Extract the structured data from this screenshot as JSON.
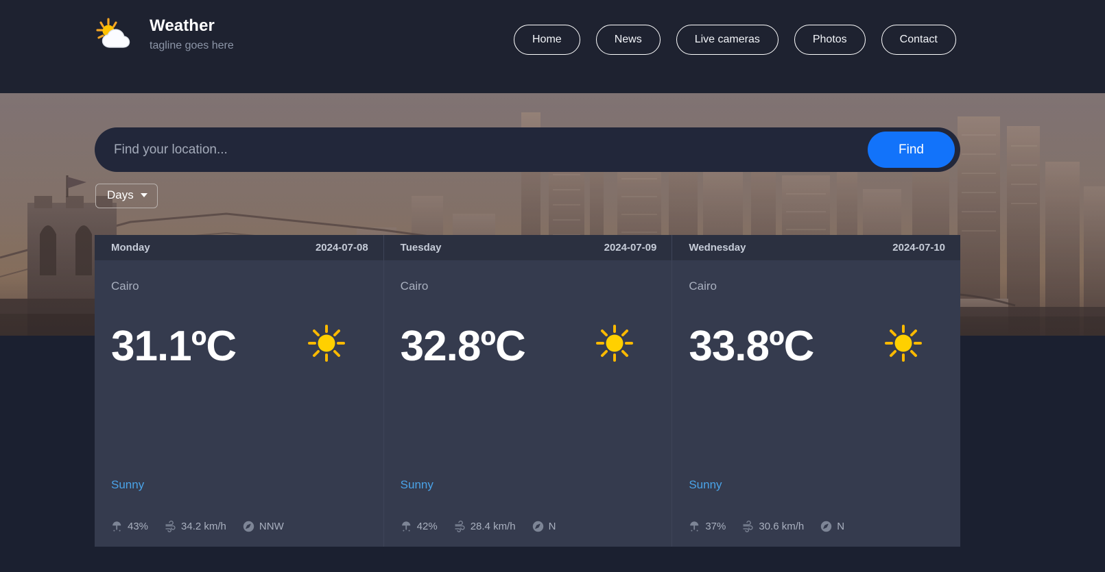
{
  "brand": {
    "title": "Weather",
    "tagline": "tagline goes here",
    "logo_icon": "sun-behind-cloud-icon"
  },
  "nav": {
    "items": [
      {
        "label": "Home"
      },
      {
        "label": "News"
      },
      {
        "label": "Live cameras"
      },
      {
        "label": "Photos"
      },
      {
        "label": "Contact"
      }
    ]
  },
  "search": {
    "placeholder": "Find your location...",
    "value": "",
    "button_label": "Find"
  },
  "filter": {
    "days_label": "Days"
  },
  "colors": {
    "accent_blue": "#1273fa",
    "link_blue": "#4aa3e8",
    "navbar_bg": "#1e2230",
    "card_bg": "#353b4e",
    "card_head_bg": "#2b3040",
    "page_bg": "#1b2030",
    "sun_yellow": "#ffc400"
  },
  "forecast": {
    "cards": [
      {
        "weekday": "Monday",
        "date": "2024-07-08",
        "city": "Cairo",
        "temperature": "31.1ºC",
        "icon": "sun-icon",
        "condition": "Sunny",
        "precipitation": "43%",
        "wind": "34.2 km/h",
        "wind_direction": "NNW"
      },
      {
        "weekday": "Tuesday",
        "date": "2024-07-09",
        "city": "Cairo",
        "temperature": "32.8ºC",
        "icon": "sun-icon",
        "condition": "Sunny",
        "precipitation": "42%",
        "wind": "28.4 km/h",
        "wind_direction": "N"
      },
      {
        "weekday": "Wednesday",
        "date": "2024-07-10",
        "city": "Cairo",
        "temperature": "33.8ºC",
        "icon": "sun-icon",
        "condition": "Sunny",
        "precipitation": "37%",
        "wind": "30.6 km/h",
        "wind_direction": "N"
      }
    ]
  }
}
